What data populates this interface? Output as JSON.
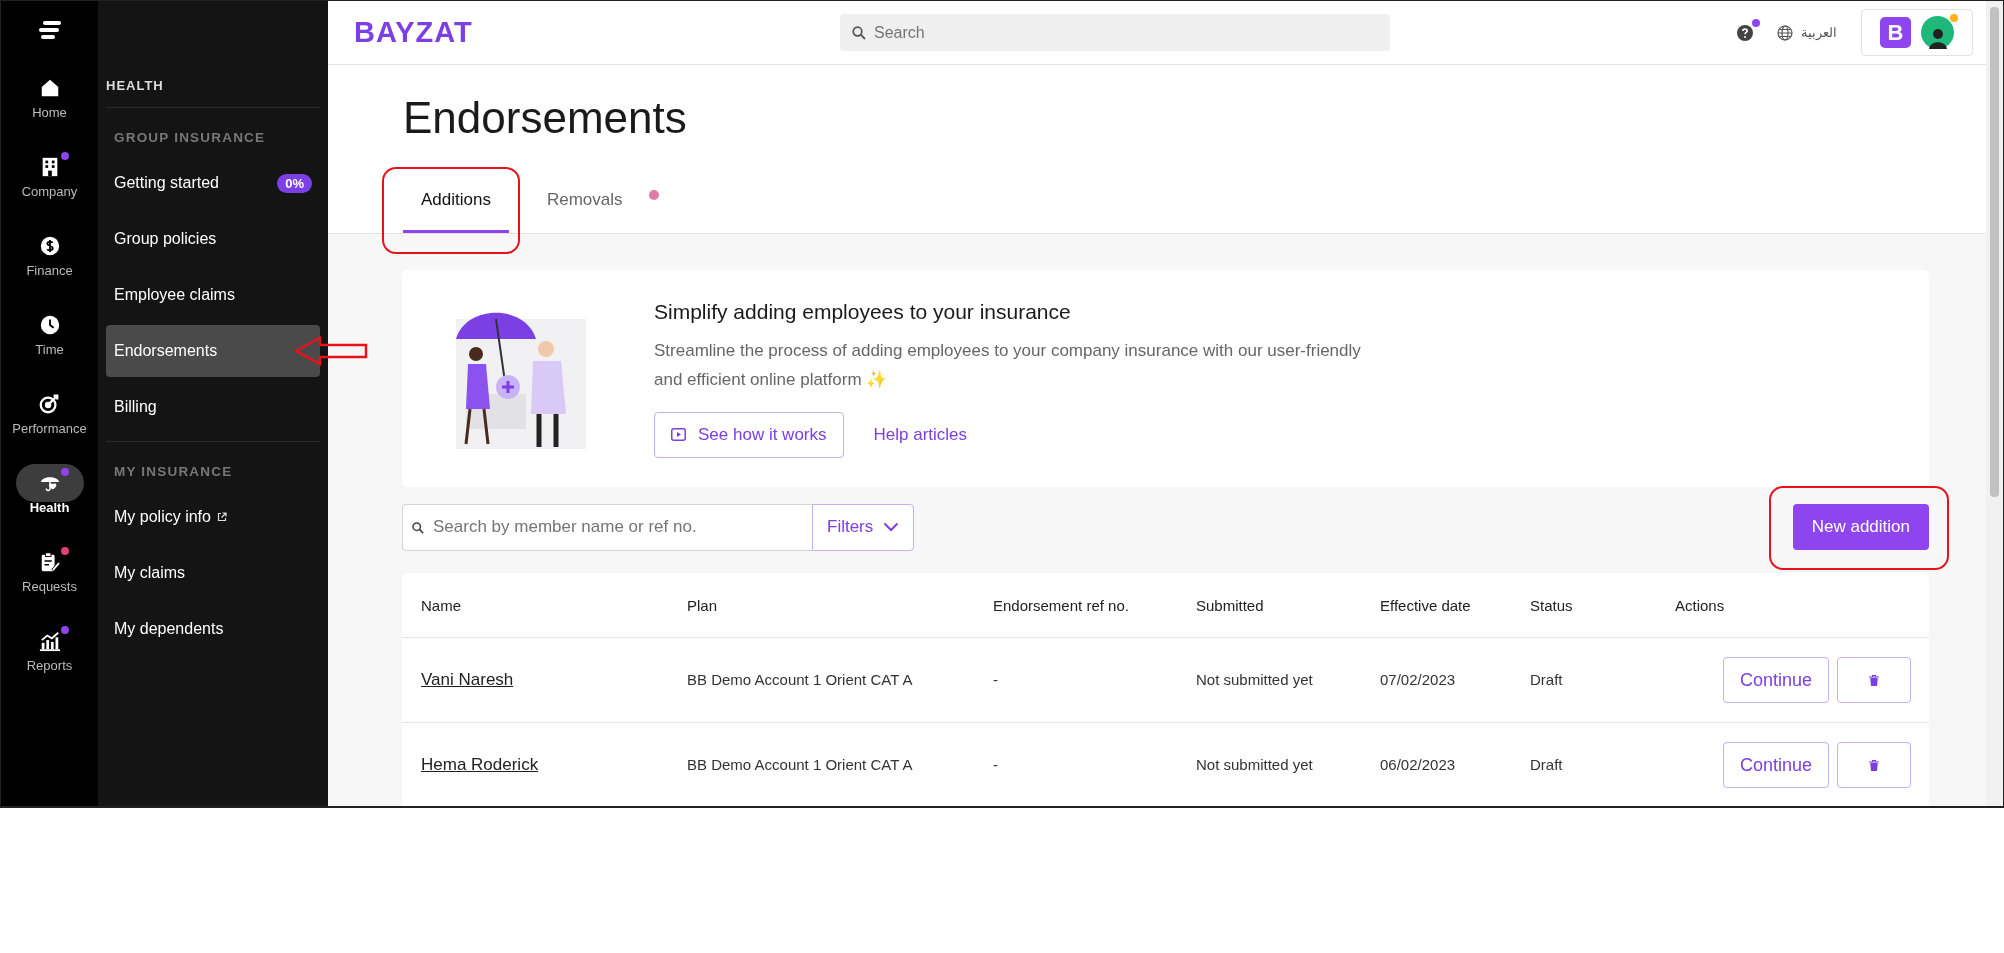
{
  "rail": {
    "items": [
      {
        "label": "Home",
        "selected": false
      },
      {
        "label": "Company",
        "selected": false,
        "color": "#8e44ef"
      },
      {
        "label": "Finance",
        "selected": false
      },
      {
        "label": "Time",
        "selected": false
      },
      {
        "label": "Performance",
        "selected": false
      },
      {
        "label": "Health",
        "selected": true,
        "color": "#8e44ef"
      },
      {
        "label": "Requests",
        "selected": false,
        "color": "#e0407b"
      },
      {
        "label": "Reports",
        "selected": false,
        "color": "#8e44ef"
      }
    ]
  },
  "subnav": {
    "title": "HEALTH",
    "groups": [
      {
        "heading": "GROUP INSURANCE",
        "items": [
          {
            "label": "Getting started",
            "selected": false,
            "badge": "0%"
          },
          {
            "label": "Group policies",
            "selected": false
          },
          {
            "label": "Employee claims",
            "selected": false
          },
          {
            "label": "Endorsements",
            "selected": true,
            "pointed": true
          },
          {
            "label": "Billing",
            "selected": false
          }
        ]
      },
      {
        "heading": "MY INSURANCE",
        "items": [
          {
            "label": "My policy info",
            "selected": false,
            "external": true
          },
          {
            "label": "My claims",
            "selected": false
          },
          {
            "label": "My dependents",
            "selected": false
          }
        ]
      }
    ]
  },
  "topbar": {
    "logo": "BAYZAT",
    "search": {
      "placeholder": "Search"
    },
    "help_alert": true,
    "language": "العربية",
    "company_initial": "B",
    "avatar_alert": true
  },
  "page": {
    "title": "Endorsements",
    "tabs": [
      {
        "label": "Additions",
        "selected": true,
        "alert": false,
        "highlighted": true
      },
      {
        "label": "Removals",
        "selected": false,
        "alert": true,
        "highlighted": false
      }
    ]
  },
  "banner": {
    "title": "Simplify adding employees to your insurance",
    "text": "Streamline the process of adding employees to your company insurance with our user-friendly and efficient online platform ✨",
    "video_button": "See how it works",
    "help_link": "Help articles"
  },
  "toolbar": {
    "search": {
      "placeholder": "Search by member name or ref no."
    },
    "filters": "Filters",
    "new_button": {
      "label": "New addition",
      "highlighted": true
    }
  },
  "table": {
    "columns": [
      "Name",
      "Plan",
      "Endorsement ref no.",
      "Submitted",
      "Effective date",
      "Status",
      "Actions"
    ],
    "rows": [
      {
        "name": "Vani Naresh",
        "plan": "BB Demo Account 1 Orient CAT A",
        "ref": "-",
        "submitted": "Not submitted yet",
        "effective": "07/02/2023",
        "status": "Draft",
        "action": "Continue"
      },
      {
        "name": "Hema Roderick",
        "plan": "BB Demo Account 1 Orient CAT A",
        "ref": "-",
        "submitted": "Not submitted yet",
        "effective": "06/02/2023",
        "status": "Draft",
        "action": "Continue"
      }
    ]
  }
}
